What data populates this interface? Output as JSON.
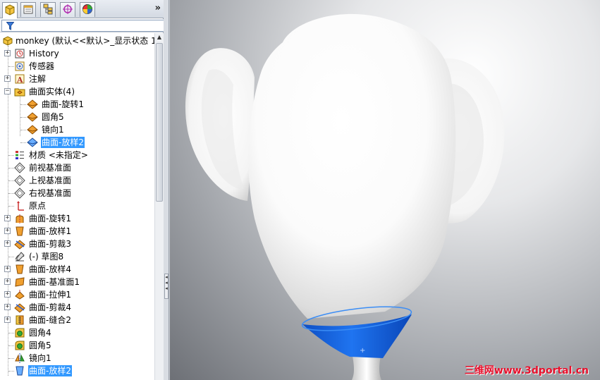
{
  "toolbar": {
    "tabs": [
      {
        "icon": "feature-manager-icon"
      },
      {
        "icon": "property-manager-icon"
      },
      {
        "icon": "configuration-manager-icon"
      },
      {
        "icon": "dimxpert-icon"
      },
      {
        "icon": "display-manager-icon"
      }
    ],
    "collapse_glyph": "»"
  },
  "tree": {
    "root_label": "monkey  (默认<<默认>_显示状态 1",
    "items": [
      {
        "label": "History",
        "icon": "history-icon"
      },
      {
        "label": "传感器",
        "icon": "sensor-icon"
      },
      {
        "label": "注解",
        "icon": "annotation-icon"
      },
      {
        "label": "曲面实体(4)",
        "icon": "surface-bodies-folder-icon"
      },
      {
        "label": "曲面-旋转1",
        "icon": "surface-body-icon"
      },
      {
        "label": "圆角5",
        "icon": "surface-body-icon"
      },
      {
        "label": "镜向1",
        "icon": "surface-body-icon"
      },
      {
        "label": "曲面-放样2",
        "icon": "surface-body-icon",
        "selected": true
      },
      {
        "label": "材质 <未指定>",
        "icon": "material-icon"
      },
      {
        "label": "前视基准面",
        "icon": "plane-icon"
      },
      {
        "label": "上视基准面",
        "icon": "plane-icon"
      },
      {
        "label": "右视基准面",
        "icon": "plane-icon"
      },
      {
        "label": "原点",
        "icon": "origin-icon"
      },
      {
        "label": "曲面-旋转1",
        "icon": "surface-revolve-icon"
      },
      {
        "label": "曲面-放样1",
        "icon": "surface-loft-icon"
      },
      {
        "label": "曲面-剪裁3",
        "icon": "surface-trim-icon"
      },
      {
        "label": "(-) 草图8",
        "icon": "sketch-icon"
      },
      {
        "label": "曲面-放样4",
        "icon": "surface-loft-icon"
      },
      {
        "label": "曲面-基准面1",
        "icon": "planar-surface-icon"
      },
      {
        "label": "曲面-拉伸1",
        "icon": "surface-extrude-icon"
      },
      {
        "label": "曲面-剪裁4",
        "icon": "surface-trim-icon"
      },
      {
        "label": "曲面-缝合2",
        "icon": "surface-knit-icon"
      },
      {
        "label": "圆角4",
        "icon": "fillet-icon"
      },
      {
        "label": "圆角5",
        "icon": "fillet-icon"
      },
      {
        "label": "镜向1",
        "icon": "mirror-icon"
      },
      {
        "label": "曲面-放样2",
        "icon": "surface-loft-icon",
        "selected": true
      }
    ]
  },
  "viewport": {
    "model": "monkey",
    "highlight_color": "#1565e8",
    "watermark": "三维网www.3dportal.cn"
  }
}
